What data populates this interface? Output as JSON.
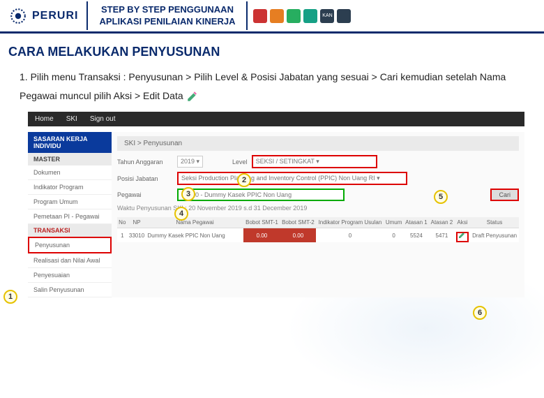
{
  "header": {
    "logo_text": "PERURI",
    "title_line1": "STEP BY STEP PENGGUNAAN",
    "title_line2": "APLIKASI PENILAIAN KINERJA",
    "kan_label": "KAN"
  },
  "section_title": "CARA MELAKUKAN PENYUSUNAN",
  "step_text": "1.  Pilih menu Transaksi : Penyusunan > Pilih Level & Posisi Jabatan yang sesuai > Cari kemudian setelah Nama Pegawai muncul pilih Aksi > Edit Data",
  "topbar": {
    "home": "Home",
    "ski": "SKI",
    "signout": "Sign out"
  },
  "crumb": "SKI > Penyusunan",
  "sidebar": {
    "group1": "SASARAN KERJA INDIVIDU",
    "master": "MASTER",
    "items_master": [
      "Dokumen",
      "Indikator Program",
      "Program Umum",
      "Pemetaan PI - Pegawai"
    ],
    "transaksi": "TRANSAKSI",
    "items_trans": [
      "Penyusunan",
      "Realisasi dan Nilai Awal",
      "Penyesuaian",
      "Salin Penyusunan"
    ]
  },
  "form": {
    "tahun_lbl": "Tahun Anggaran",
    "tahun_val": "2019 ▾",
    "level_lbl": "Level",
    "level_val": "SEKSI / SETINGKAT ▾",
    "posisi_lbl": "Posisi Jabatan",
    "posisi_val": "Seksi Production Planning and Inventory Control (PPIC) Non Uang RI ▾",
    "pegawai_lbl": "Pegawai",
    "pegawai_val": "33010 - Dummy Kasek PPIC Non Uang",
    "cari": "Cari",
    "waktu": "Waktu Penyusunan SKI : 20 November 2019 s.d 31 December 2019"
  },
  "table": {
    "headers": [
      "No",
      "NP",
      "Nama Pegawai",
      "Bobot SMT-1",
      "Bobot SMT-2",
      "Indikator Program Usulan",
      "Umum",
      "Atasan 1",
      "Atasan 2",
      "Aksi",
      "Status"
    ],
    "row": {
      "no": "1",
      "np": "33010",
      "nama": "Dummy Kasek PPIC Non Uang",
      "b1": "0.00",
      "b2": "0.00",
      "usulan": "0",
      "umum": "0",
      "a1": "5524",
      "a2": "5471",
      "status": "Draft Penyusunan"
    }
  },
  "nums": {
    "n1": "1",
    "n2": "2",
    "n3": "3",
    "n4": "4",
    "n5": "5",
    "n6": "6"
  }
}
